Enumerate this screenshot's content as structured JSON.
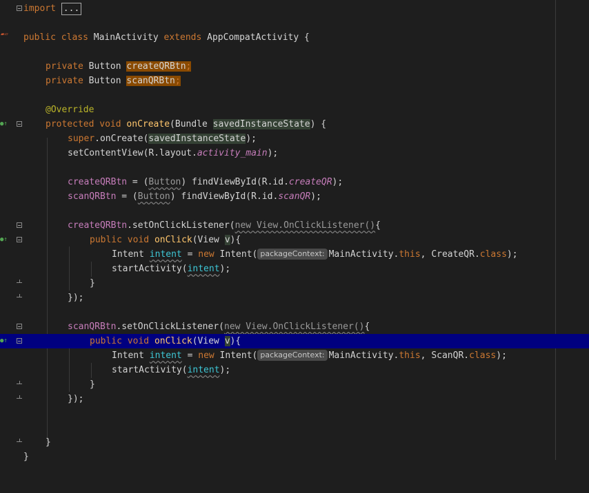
{
  "editor": {
    "import_keyword": "import",
    "import_folded": "...",
    "class_decl": {
      "public": "public",
      "class": "class",
      "name": "MainActivity",
      "extends": "extends",
      "super": "AppCompatActivity",
      "brace": "{"
    },
    "fields": [
      {
        "mod": "private",
        "type": "Button",
        "name": "createQRBtn",
        "end": ";"
      },
      {
        "mod": "private",
        "type": "Button",
        "name": "scanQRBtn",
        "end": ";"
      }
    ],
    "annotation": "@Override",
    "oncreate": {
      "protected": "protected",
      "void": "void",
      "name": "onCreate",
      "open": "(Bundle ",
      "param": "savedInstanceState",
      "close": ") {"
    },
    "super_call": {
      "super": "super",
      "rest": ".onCreate(",
      "param": "savedInstanceState",
      "end": ");"
    },
    "set_content": {
      "pre": "setContentView(R.layout.",
      "res": "activity_main",
      "end": ");"
    },
    "find1": {
      "field": "createQRBtn",
      "eq": " = (",
      "cast": "Button",
      "mid": ") findViewById(R.id.",
      "res": "createQR",
      "end": ");"
    },
    "find2": {
      "field": "scanQRBtn",
      "eq": " = (",
      "cast": "Button",
      "mid": ") findViewById(R.id.",
      "res": "scanQR",
      "end": ");"
    },
    "listener1": {
      "field": "createQRBtn",
      "call": ".setOnClickListener(",
      "anon": "new View.OnClickListener()",
      "brace": "{"
    },
    "onclick1": {
      "public": "public",
      "void": "void",
      "name": "onClick",
      "open": "(View ",
      "param": "v",
      "close": "){"
    },
    "intent1": {
      "type": "Intent ",
      "var": "intent",
      "eq": " = ",
      "new": "new",
      "ctor": " Intent(",
      "hint": "packageContext:",
      "ctx": "MainActivity.",
      "this": "this",
      "comma": ", CreateQR.",
      "cls": "class",
      "end": ");"
    },
    "start1": {
      "pre": "startActivity(",
      "var": "intent",
      "end": ");"
    },
    "close_brace": "}",
    "close_listener": "});",
    "listener2": {
      "field": "scanQRBtn",
      "call": ".setOnClickListener(",
      "anon": "new View.OnClickListener()",
      "brace": "{"
    },
    "onclick2": {
      "public": "public",
      "void": "void",
      "name": "onClick",
      "open": "(View ",
      "param": "v",
      "close": "){"
    },
    "intent2": {
      "type": "Intent ",
      "var": "intent",
      "eq": " = ",
      "new": "new",
      "ctor": " Intent(",
      "hint": "packageContext:",
      "ctx": "MainActivity.",
      "this": "this",
      "comma": ", ScanQR.",
      "cls": "class",
      "end": ");"
    },
    "start2": {
      "pre": "startActivity(",
      "var": "intent",
      "end": ");"
    }
  },
  "colors": {
    "background": "#1e1e1e",
    "keyword": "#cc7832",
    "method": "#ffc66d",
    "field": "#c77dbb",
    "annotation": "#bbb529",
    "local": "#3ec7d6",
    "caret_line": "#000080"
  },
  "icons": {
    "implements": "implements-icon",
    "override": "override-gutter-icon",
    "fold": "fold-toggle-icon"
  }
}
